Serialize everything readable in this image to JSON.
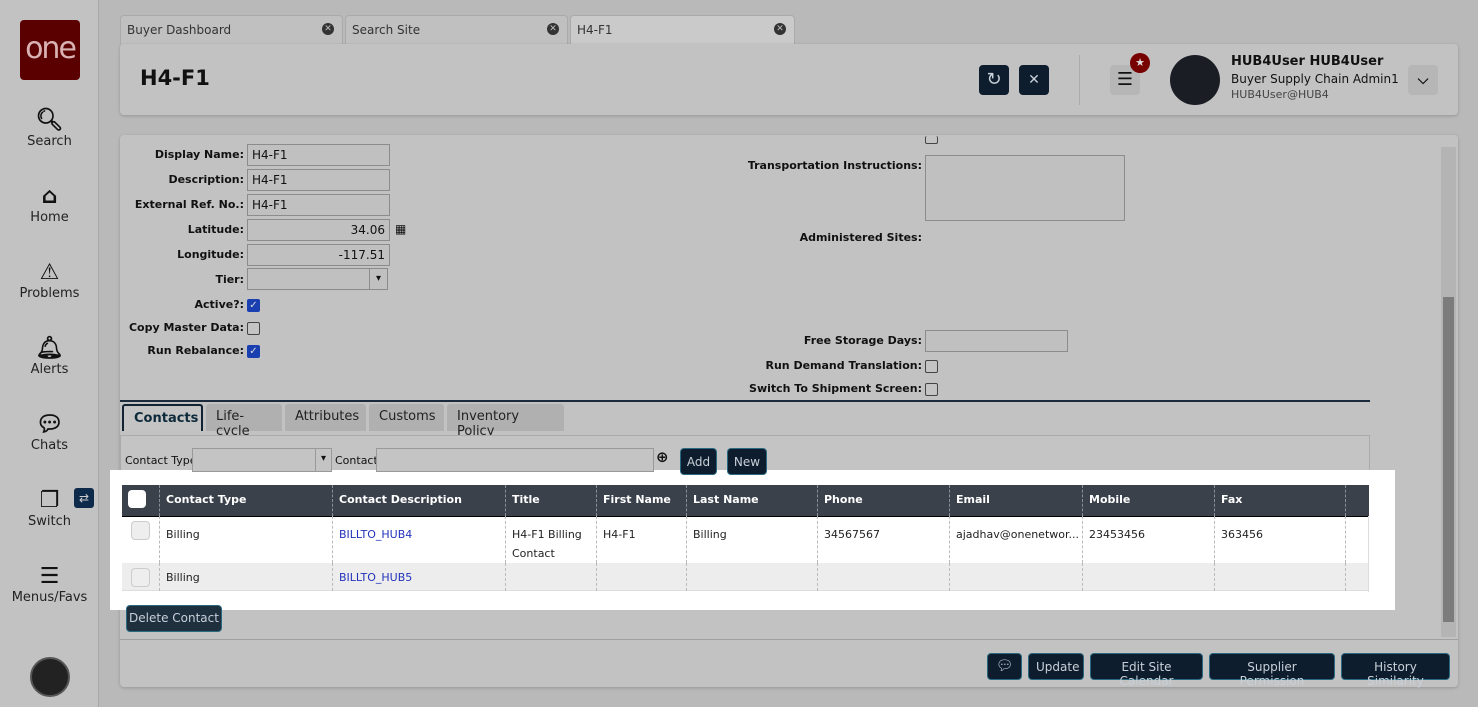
{
  "sidebar": {
    "logo": "one",
    "items": [
      {
        "label": "Search",
        "icon": "search-icon"
      },
      {
        "label": "Home",
        "icon": "home-icon"
      },
      {
        "label": "Problems",
        "icon": "warning-icon"
      },
      {
        "label": "Alerts",
        "icon": "bell-icon"
      },
      {
        "label": "Chats",
        "icon": "chat-icon"
      },
      {
        "label": "Switch",
        "icon": "switch-icon"
      },
      {
        "label": "Menus/Favs",
        "icon": "menu-icon"
      }
    ]
  },
  "tabs": [
    {
      "label": "Buyer Dashboard"
    },
    {
      "label": "Search Site"
    },
    {
      "label": "H4-F1"
    }
  ],
  "header": {
    "title": "H4-F1",
    "user_name": "HUB4User HUB4User",
    "user_role": "Buyer Supply Chain Admin1",
    "user_email": "HUB4User@HUB4"
  },
  "form": {
    "display_name": {
      "label": "Display Name:",
      "value": "H4-F1"
    },
    "description": {
      "label": "Description:",
      "value": "H4-F1"
    },
    "external_ref": {
      "label": "External Ref. No.:",
      "value": "H4-F1"
    },
    "latitude": {
      "label": "Latitude:",
      "value": "34.06"
    },
    "longitude": {
      "label": "Longitude:",
      "value": "-117.51"
    },
    "tier": {
      "label": "Tier:",
      "value": ""
    },
    "active": {
      "label": "Active?:",
      "checked": true
    },
    "copy_master": {
      "label": "Copy Master Data:",
      "checked": false
    },
    "run_rebalance": {
      "label": "Run Rebalance:",
      "checked": true
    },
    "transport": {
      "label": "Transportation Instructions:",
      "value": ""
    },
    "administered": {
      "label": "Administered Sites:"
    },
    "free_storage": {
      "label": "Free Storage Days:",
      "value": ""
    },
    "run_demand": {
      "label": "Run Demand Translation:",
      "checked": false
    },
    "switch_shipment": {
      "label": "Switch To Shipment Screen:",
      "checked": false
    }
  },
  "subtabs": [
    "Contacts",
    "Life-cycle",
    "Attributes",
    "Customs",
    "Inventory Policy"
  ],
  "filter": {
    "contact_type_label": "Contact Type",
    "contact_label": "Contact",
    "add": "Add",
    "new": "New"
  },
  "table": {
    "columns": [
      "Contact Type",
      "Contact Description",
      "Title",
      "First Name",
      "Last Name",
      "Phone",
      "Email",
      "Mobile",
      "Fax"
    ],
    "rows": [
      [
        "Billing",
        "BILLTO_HUB4",
        "H4-F1 Billing Contact",
        "H4-F1",
        "Billing",
        "34567567",
        "ajadhav@onenetwor...",
        "23453456",
        "363456"
      ],
      [
        "Billing",
        "BILLTO_HUB5",
        "",
        "",
        "",
        "",
        "",
        "",
        ""
      ]
    ]
  },
  "delete_contact": "Delete Contact",
  "footer": {
    "update": "Update",
    "edit_calendar": "Edit Site Calendar",
    "supplier_permission": "Supplier Permission",
    "history_similarity": "History Similarity"
  },
  "colors": {
    "brand": "#5a0000",
    "dark_button": "#0e1d2e",
    "table_header": "#3a414b",
    "link": "#2233bb"
  }
}
